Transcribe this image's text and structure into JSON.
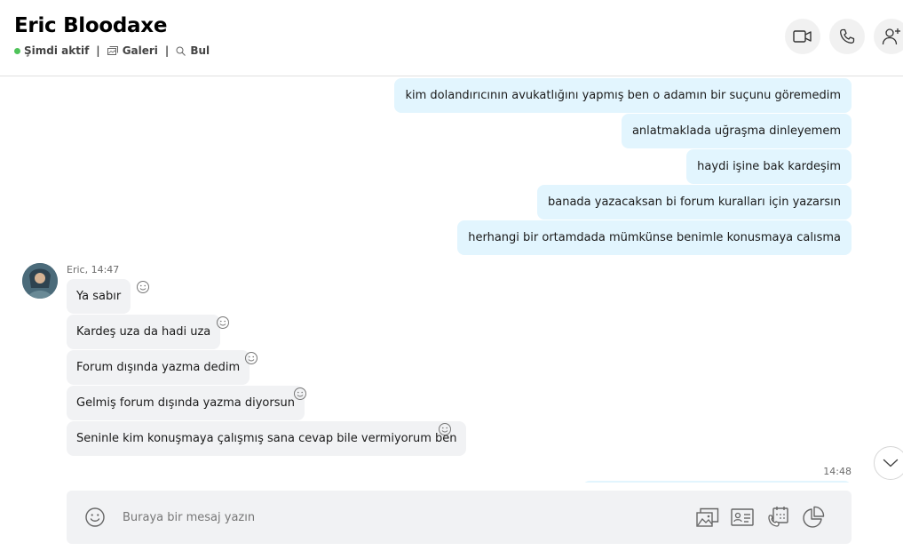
{
  "header": {
    "contact_name": "Eric Bloodaxe",
    "status": "Şimdi aktif",
    "separator": "|",
    "gallery_label": "Galeri",
    "find_label": "Bul"
  },
  "messages": {
    "outgoing": [
      "kim dolandırıcının avukatlığını yapmış ben o adamın bir suçunu göremedim",
      "anlatmaklada uğraşma dinleyemem",
      "haydi işine bak kardeşim",
      "banada yazacaksan bi forum kuralları için yazarsın",
      "herhangi bir ortamdada mümkünse benimle konusmaya calısma"
    ],
    "incoming_meta": "Eric, 14:47",
    "incoming": [
      "Ya sabır",
      "Kardeş uza da hadi uza",
      "Forum dışında yazma dedim",
      "Gelmiş forum dışında yazma diyorsun",
      "Seninle kim konuşmaya çalışmış sana cevap bile vermiyorum ben"
    ],
    "next_time": "14:48"
  },
  "composer": {
    "placeholder": "Buraya bir mesaj yazın"
  },
  "colors": {
    "outgoing_bubble": "#e2f5fe",
    "incoming_bubble": "#f1f2f4",
    "online": "#4fc35a"
  },
  "icons": [
    "video-call-icon",
    "phone-icon",
    "add-person-icon",
    "gallery-icon",
    "search-icon",
    "smiley-icon",
    "media-icon",
    "contact-card-icon",
    "schedule-call-icon",
    "poll-icon",
    "chevron-down-icon"
  ]
}
